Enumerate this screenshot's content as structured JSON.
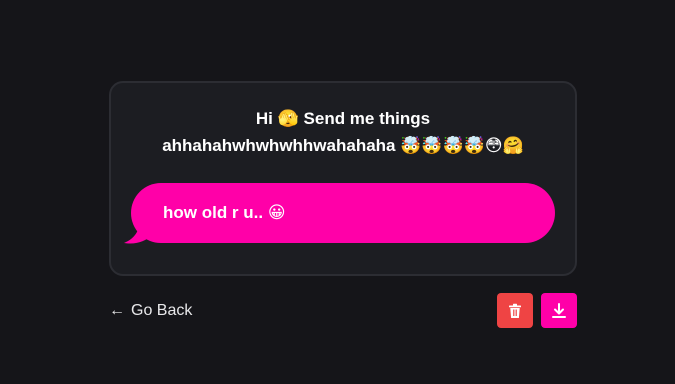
{
  "card": {
    "prompt_line1": "Hi 🫣 Send me things",
    "prompt_line2": "ahhahahwhwhwhhwahahaha 🤯🤯🤯🤯😳🤗",
    "message": "how old r u.. 😀"
  },
  "footer": {
    "go_back_arrow": "←",
    "go_back_label": "Go Back",
    "delete_icon": "trash-icon",
    "download_icon": "download-icon"
  },
  "colors": {
    "background": "#151519",
    "card": "#1c1d22",
    "accent": "#ff00a8",
    "danger": "#ef4444"
  }
}
